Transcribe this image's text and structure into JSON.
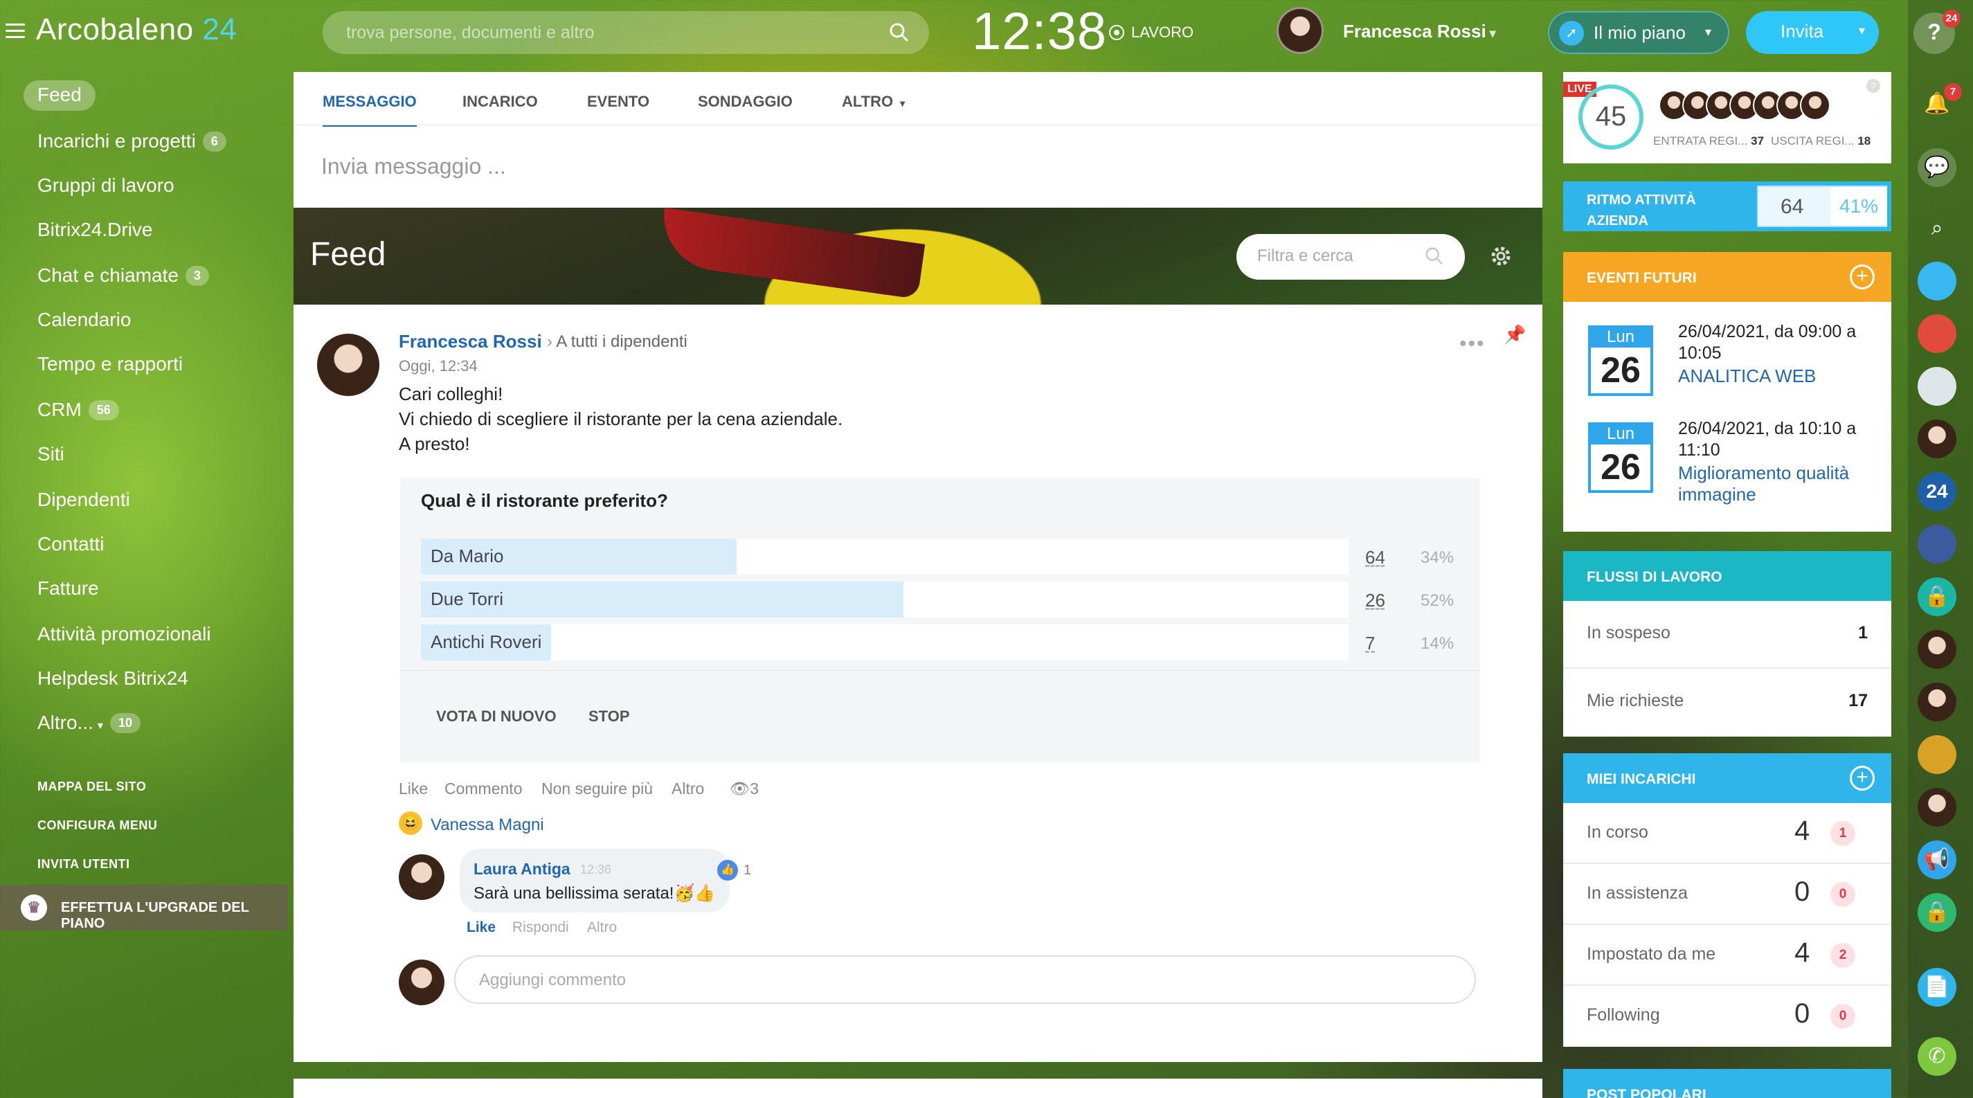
{
  "header": {
    "logo_text": "Arcobaleno",
    "logo_num": "24",
    "search_placeholder": "trova persone, documenti e altro",
    "clock": "12:38",
    "work_status": "LAVORO",
    "user_name": "Francesca Rossi",
    "plan_label": "Il mio piano",
    "invite_label": "Invita"
  },
  "sidebar": {
    "active": "Feed",
    "items": [
      {
        "label": "Incarichi e progetti",
        "count": "6"
      },
      {
        "label": "Gruppi di lavoro"
      },
      {
        "label": "Bitrix24.Drive"
      },
      {
        "label": "Chat e chiamate",
        "count": "3"
      },
      {
        "label": "Calendario"
      },
      {
        "label": "Tempo e rapporti"
      },
      {
        "label": "CRM",
        "count": "56"
      },
      {
        "label": "Siti"
      },
      {
        "label": "Dipendenti"
      },
      {
        "label": "Contatti"
      },
      {
        "label": "Fatture"
      },
      {
        "label": "Attività promozionali"
      },
      {
        "label": "Helpdesk Bitrix24"
      },
      {
        "label": "Altro...",
        "count": "10"
      }
    ],
    "site_map": "MAPPA DEL SITO",
    "configure_menu": "CONFIGURA MENU",
    "invite_users": "INVITA UTENTI",
    "upgrade": "EFFETTUA L'UPGRADE DEL PIANO"
  },
  "composer": {
    "tabs": [
      "MESSAGGIO",
      "INCARICO",
      "EVENTO",
      "SONDAGGIO",
      "ALTRO"
    ],
    "placeholder": "Invia messaggio ..."
  },
  "feed": {
    "title": "Feed",
    "filter_placeholder": "Filtra e cerca"
  },
  "post": {
    "author": "Francesca Rossi",
    "recipients": "A tutti i dipendenti",
    "time": "Oggi, 12:34",
    "lines": [
      "Cari colleghi!",
      "Vi chiedo di scegliere il ristorante per la cena aziendale.",
      "A presto!"
    ],
    "poll": {
      "question": "Qual è il ristorante preferito?",
      "options": [
        {
          "label": "Da Mario",
          "votes": "64",
          "percent": "34%",
          "fraction": 0.34
        },
        {
          "label": "Due Torri",
          "votes": "26",
          "percent": "52%",
          "fraction": 0.52
        },
        {
          "label": "Antichi Roveri",
          "votes": "7",
          "percent": "14%",
          "fraction": 0.14
        }
      ],
      "vote_again": "VOTA DI NUOVO",
      "stop": "STOP"
    },
    "actions": [
      "Like",
      "Commento",
      "Non seguire più",
      "Altro"
    ],
    "views": "3",
    "reaction_user": "Vanessa Magni",
    "comment": {
      "author": "Laura Antiga",
      "time": "12:36",
      "text": "Sarà una bellissima serata!🥳👍",
      "likes": "1",
      "actions": [
        "Like",
        "Rispondi",
        "Altro"
      ]
    },
    "add_comment_placeholder": "Aggiungi commento"
  },
  "live": {
    "tag": "LIVE",
    "count": "45",
    "in_label": "ENTRATA REGI...",
    "in_count": "37",
    "out_label": "USCITA REGI...",
    "out_count": "18"
  },
  "ritmo": {
    "label_1": "RITMO ATTIVITÀ",
    "label_2": "AZIENDA",
    "value": "64",
    "percent": "41%"
  },
  "events": {
    "title": "EVENTI FUTURI",
    "items": [
      {
        "day": "Lun",
        "num": "26",
        "date_1": "26/04/2021, da 09:00 a",
        "date_2": "10:05",
        "name_1": "ANALITICA WEB",
        "name_2": ""
      },
      {
        "day": "Lun",
        "num": "26",
        "date_1": "26/04/2021, da 10:10 a",
        "date_2": "11:10",
        "name_1": "Miglioramento qualità",
        "name_2": "immagine"
      }
    ]
  },
  "workflows": {
    "title": "FLUSSI DI LAVORO",
    "rows": [
      {
        "label": "In sospeso",
        "value": "1"
      },
      {
        "label": "Mie richieste",
        "value": "17"
      }
    ]
  },
  "tasks": {
    "title": "MIEI INCARICHI",
    "rows": [
      {
        "label": "In corso",
        "value": "4",
        "badge": "1"
      },
      {
        "label": "In assistenza",
        "value": "0",
        "badge": "0"
      },
      {
        "label": "Impostato da me",
        "value": "4",
        "badge": "2"
      },
      {
        "label": "Following",
        "value": "0",
        "badge": "0"
      }
    ]
  },
  "popular": {
    "title": "POST POPOLARI"
  },
  "rightbar": {
    "help_badge": "24",
    "notif_badge": "7",
    "logo24": "24"
  },
  "colors": {
    "accent": "#2fc7f7",
    "link": "#2067b0",
    "events_header": "#f5a623",
    "workflows_header": "#1cb7c4",
    "tasks_header": "#2fb5e9"
  }
}
